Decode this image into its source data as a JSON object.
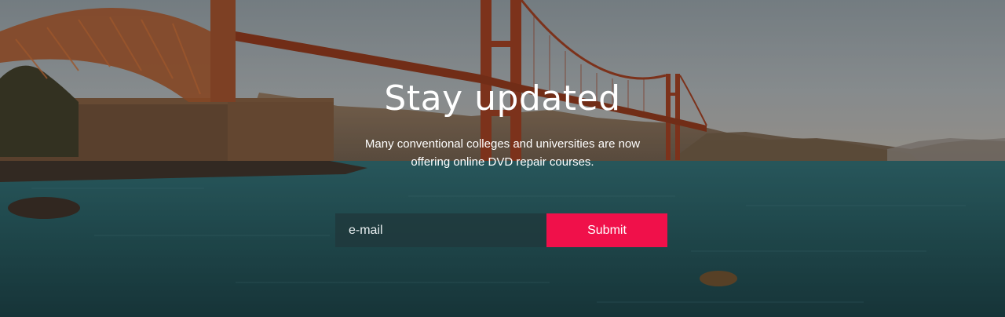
{
  "newsletter": {
    "title": "Stay updated",
    "description": "Many conventional colleges and universities are now offering online DVD repair courses.",
    "email_placeholder": "e-mail",
    "submit_label": "Submit"
  },
  "colors": {
    "submit_button": "#f0104a",
    "email_field": "#20383c",
    "sky": "#9aa5aa",
    "water": "#1f5a60",
    "bridge": "#b3441e"
  },
  "background": {
    "scene": "Golden Gate Bridge over water"
  }
}
